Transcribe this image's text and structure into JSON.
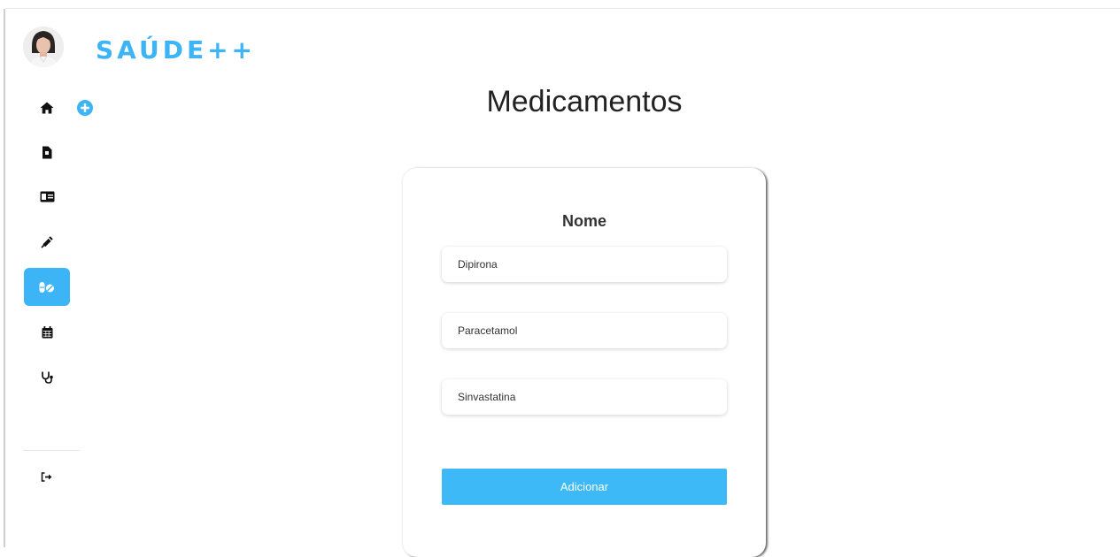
{
  "app": {
    "brand": "SAÚDE++"
  },
  "sidebar": {
    "items": [
      {
        "name": "home",
        "icon": "home-icon",
        "active": false
      },
      {
        "name": "documents",
        "icon": "file-icon",
        "active": false
      },
      {
        "name": "id-card",
        "icon": "id-card-icon",
        "active": false
      },
      {
        "name": "vaccines",
        "icon": "syringe-icon",
        "active": false
      },
      {
        "name": "medicines",
        "icon": "pills-icon",
        "active": true
      },
      {
        "name": "calendar",
        "icon": "calendar-icon",
        "active": false
      },
      {
        "name": "doctor",
        "icon": "stethoscope-icon",
        "active": false
      }
    ],
    "logout_icon": "sign-out-icon",
    "add_icon": "plus-circle-icon"
  },
  "page": {
    "title": "Medicamentos"
  },
  "form": {
    "label": "Nome",
    "fields": [
      "Dipirona",
      "Paracetamol",
      "Sinvastatina"
    ],
    "submit_label": "Adicionar"
  },
  "colors": {
    "accent": "#3db4f5",
    "button": "#3db9f8",
    "icon": "#111111",
    "title": "#222222"
  }
}
